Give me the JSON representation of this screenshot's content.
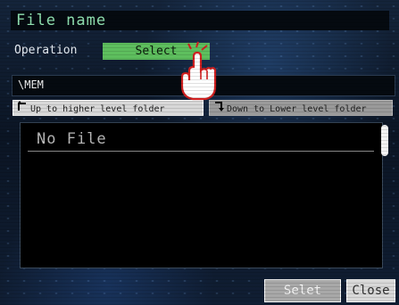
{
  "title": "File name",
  "operation": {
    "label": "Operation",
    "value": "Select"
  },
  "path": "\\MEM",
  "nav": {
    "up_label": "Up to higher level folder",
    "down_label": "Down to Lower level folder"
  },
  "file_list": {
    "items": [
      "No File"
    ]
  },
  "buttons": {
    "selet_label": "Selet",
    "close_label": "Close"
  },
  "icons": {
    "up": "arrow-up-folder-icon",
    "down": "arrow-down-folder-icon",
    "pointer": "tap-hand-icon"
  },
  "colors": {
    "accent_green": "#5ebf5e",
    "title_text": "#8fe0b0"
  }
}
